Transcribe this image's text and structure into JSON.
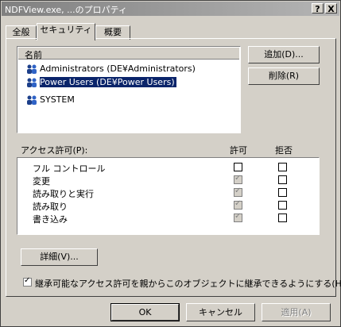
{
  "window": {
    "title": "NDFView.exe, ...のプロパティ",
    "help_button": "?",
    "close_button": "X"
  },
  "tabs": [
    {
      "label": "全般",
      "selected": false
    },
    {
      "label": "セキュリティ",
      "selected": true
    },
    {
      "label": "概要",
      "selected": false
    }
  ],
  "users": {
    "column_header": "名前",
    "items": [
      {
        "name": "Administrators (DE¥Administrators)",
        "selected": false
      },
      {
        "name": "Power Users (DE¥Power Users)",
        "selected": true
      },
      {
        "name": "SYSTEM",
        "selected": false
      }
    ],
    "add_button": "追加(D)...",
    "remove_button": "削除(R)"
  },
  "permissions": {
    "header_label": "アクセス許可(P):",
    "allow_header": "許可",
    "deny_header": "拒否",
    "items": [
      {
        "name": "フル コントロール",
        "allow": false,
        "deny": false
      },
      {
        "name": "変更",
        "allow": true,
        "deny": false
      },
      {
        "name": "読み取りと実行",
        "allow": true,
        "deny": false
      },
      {
        "name": "読み取り",
        "allow": true,
        "deny": false
      },
      {
        "name": "書き込み",
        "allow": true,
        "deny": false
      }
    ]
  },
  "advanced_button": "詳細(V)...",
  "inherit_checkbox": {
    "label": "継承可能なアクセス許可を親からこのオブジェクトに継承できるようにする(H)",
    "checked": true
  },
  "footer": {
    "ok": "OK",
    "cancel": "キャンセル",
    "apply": "適用(A)"
  }
}
